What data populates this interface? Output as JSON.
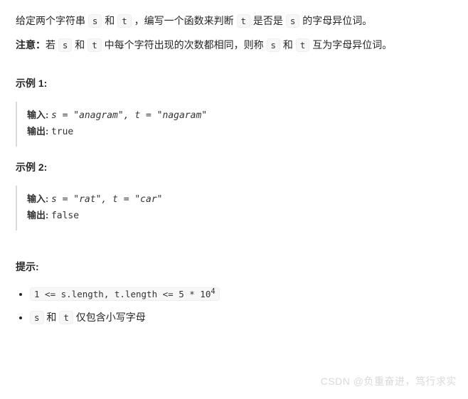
{
  "intro": {
    "pre1": "给定两个字符串 ",
    "var_s": "s",
    "mid1": " 和 ",
    "var_t": "t",
    "mid2": " ，编写一个函数来判断 ",
    "mid3": " 是否是 ",
    "post": " 的字母异位词。"
  },
  "note": {
    "label": "注意：",
    "pre": "若 ",
    "var_s": "s",
    "mid1": " 和 ",
    "var_t": "t",
    "mid2": " 中每个字符出现的次数都相同，则称 ",
    "mid3": " 和 ",
    "post": " 互为字母异位词。"
  },
  "example1": {
    "title": "示例 1:",
    "input_label": "输入: ",
    "input_value": "s = \"anagram\", t = \"nagaram\"",
    "output_label": "输出: ",
    "output_value": "true"
  },
  "example2": {
    "title": "示例 2:",
    "input_label": "输入: ",
    "input_value": "s = \"rat\", t = \"car\"",
    "output_label": "输出: ",
    "output_value": "false"
  },
  "hints": {
    "title": "提示:",
    "item1_code": "1 <= s.length, t.length <= 5 * 10",
    "item1_sup": "4",
    "item2_s": "s",
    "item2_mid": " 和 ",
    "item2_t": "t",
    "item2_post": " 仅包含小写字母"
  },
  "watermark": "CSDN @负重奋进，笃行求实"
}
